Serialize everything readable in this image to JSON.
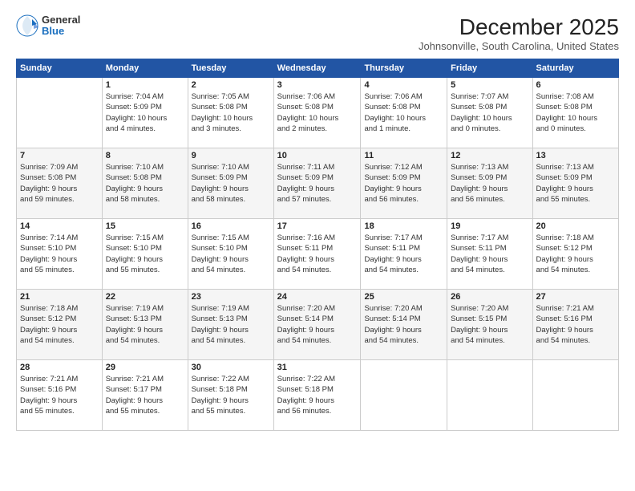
{
  "logo": {
    "general": "General",
    "blue": "Blue"
  },
  "title": "December 2025",
  "location": "Johnsonville, South Carolina, United States",
  "days_header": [
    "Sunday",
    "Monday",
    "Tuesday",
    "Wednesday",
    "Thursday",
    "Friday",
    "Saturday"
  ],
  "weeks": [
    [
      {
        "num": "",
        "info": ""
      },
      {
        "num": "1",
        "info": "Sunrise: 7:04 AM\nSunset: 5:09 PM\nDaylight: 10 hours\nand 4 minutes."
      },
      {
        "num": "2",
        "info": "Sunrise: 7:05 AM\nSunset: 5:08 PM\nDaylight: 10 hours\nand 3 minutes."
      },
      {
        "num": "3",
        "info": "Sunrise: 7:06 AM\nSunset: 5:08 PM\nDaylight: 10 hours\nand 2 minutes."
      },
      {
        "num": "4",
        "info": "Sunrise: 7:06 AM\nSunset: 5:08 PM\nDaylight: 10 hours\nand 1 minute."
      },
      {
        "num": "5",
        "info": "Sunrise: 7:07 AM\nSunset: 5:08 PM\nDaylight: 10 hours\nand 0 minutes."
      },
      {
        "num": "6",
        "info": "Sunrise: 7:08 AM\nSunset: 5:08 PM\nDaylight: 10 hours\nand 0 minutes."
      }
    ],
    [
      {
        "num": "7",
        "info": "Sunrise: 7:09 AM\nSunset: 5:08 PM\nDaylight: 9 hours\nand 59 minutes."
      },
      {
        "num": "8",
        "info": "Sunrise: 7:10 AM\nSunset: 5:08 PM\nDaylight: 9 hours\nand 58 minutes."
      },
      {
        "num": "9",
        "info": "Sunrise: 7:10 AM\nSunset: 5:09 PM\nDaylight: 9 hours\nand 58 minutes."
      },
      {
        "num": "10",
        "info": "Sunrise: 7:11 AM\nSunset: 5:09 PM\nDaylight: 9 hours\nand 57 minutes."
      },
      {
        "num": "11",
        "info": "Sunrise: 7:12 AM\nSunset: 5:09 PM\nDaylight: 9 hours\nand 56 minutes."
      },
      {
        "num": "12",
        "info": "Sunrise: 7:13 AM\nSunset: 5:09 PM\nDaylight: 9 hours\nand 56 minutes."
      },
      {
        "num": "13",
        "info": "Sunrise: 7:13 AM\nSunset: 5:09 PM\nDaylight: 9 hours\nand 55 minutes."
      }
    ],
    [
      {
        "num": "14",
        "info": "Sunrise: 7:14 AM\nSunset: 5:10 PM\nDaylight: 9 hours\nand 55 minutes."
      },
      {
        "num": "15",
        "info": "Sunrise: 7:15 AM\nSunset: 5:10 PM\nDaylight: 9 hours\nand 55 minutes."
      },
      {
        "num": "16",
        "info": "Sunrise: 7:15 AM\nSunset: 5:10 PM\nDaylight: 9 hours\nand 54 minutes."
      },
      {
        "num": "17",
        "info": "Sunrise: 7:16 AM\nSunset: 5:11 PM\nDaylight: 9 hours\nand 54 minutes."
      },
      {
        "num": "18",
        "info": "Sunrise: 7:17 AM\nSunset: 5:11 PM\nDaylight: 9 hours\nand 54 minutes."
      },
      {
        "num": "19",
        "info": "Sunrise: 7:17 AM\nSunset: 5:11 PM\nDaylight: 9 hours\nand 54 minutes."
      },
      {
        "num": "20",
        "info": "Sunrise: 7:18 AM\nSunset: 5:12 PM\nDaylight: 9 hours\nand 54 minutes."
      }
    ],
    [
      {
        "num": "21",
        "info": "Sunrise: 7:18 AM\nSunset: 5:12 PM\nDaylight: 9 hours\nand 54 minutes."
      },
      {
        "num": "22",
        "info": "Sunrise: 7:19 AM\nSunset: 5:13 PM\nDaylight: 9 hours\nand 54 minutes."
      },
      {
        "num": "23",
        "info": "Sunrise: 7:19 AM\nSunset: 5:13 PM\nDaylight: 9 hours\nand 54 minutes."
      },
      {
        "num": "24",
        "info": "Sunrise: 7:20 AM\nSunset: 5:14 PM\nDaylight: 9 hours\nand 54 minutes."
      },
      {
        "num": "25",
        "info": "Sunrise: 7:20 AM\nSunset: 5:14 PM\nDaylight: 9 hours\nand 54 minutes."
      },
      {
        "num": "26",
        "info": "Sunrise: 7:20 AM\nSunset: 5:15 PM\nDaylight: 9 hours\nand 54 minutes."
      },
      {
        "num": "27",
        "info": "Sunrise: 7:21 AM\nSunset: 5:16 PM\nDaylight: 9 hours\nand 54 minutes."
      }
    ],
    [
      {
        "num": "28",
        "info": "Sunrise: 7:21 AM\nSunset: 5:16 PM\nDaylight: 9 hours\nand 55 minutes."
      },
      {
        "num": "29",
        "info": "Sunrise: 7:21 AM\nSunset: 5:17 PM\nDaylight: 9 hours\nand 55 minutes."
      },
      {
        "num": "30",
        "info": "Sunrise: 7:22 AM\nSunset: 5:18 PM\nDaylight: 9 hours\nand 55 minutes."
      },
      {
        "num": "31",
        "info": "Sunrise: 7:22 AM\nSunset: 5:18 PM\nDaylight: 9 hours\nand 56 minutes."
      },
      {
        "num": "",
        "info": ""
      },
      {
        "num": "",
        "info": ""
      },
      {
        "num": "",
        "info": ""
      }
    ]
  ]
}
